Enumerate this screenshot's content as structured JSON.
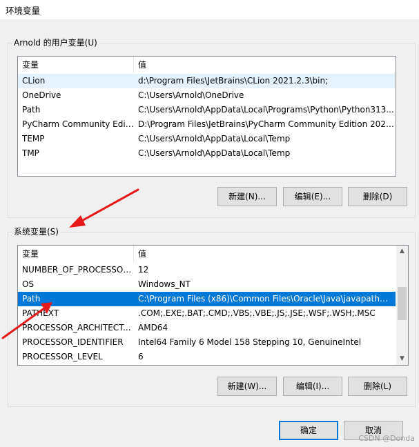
{
  "window": {
    "title": "环境变量"
  },
  "user_vars": {
    "group_label": "Arnold 的用户变量(U)",
    "columns": [
      "变量",
      "值"
    ],
    "rows": [
      {
        "name": "CLion",
        "value": "d:\\Program Files\\JetBrains\\CLion 2021.2.3\\bin;"
      },
      {
        "name": "OneDrive",
        "value": "C:\\Users\\Arnold\\OneDrive"
      },
      {
        "name": "Path",
        "value": "C:\\Users\\Arnold\\AppData\\Local\\Programs\\Python\\Python313..."
      },
      {
        "name": "PyCharm Community Editi...",
        "value": "D:\\Program Files\\JetBrains\\PyCharm Community Edition 2021..."
      },
      {
        "name": "TEMP",
        "value": "C:\\Users\\Arnold\\AppData\\Local\\Temp"
      },
      {
        "name": "TMP",
        "value": "C:\\Users\\Arnold\\AppData\\Local\\Temp"
      }
    ],
    "buttons": {
      "new": "新建(N)...",
      "edit": "编辑(E)...",
      "delete": "删除(D)"
    }
  },
  "system_vars": {
    "group_label": "系统变量(S)",
    "columns": [
      "变量",
      "值"
    ],
    "rows": [
      {
        "name": "NUMBER_OF_PROCESSORS",
        "value": "12"
      },
      {
        "name": "OS",
        "value": "Windows_NT"
      },
      {
        "name": "Path",
        "value": "C:\\Program Files (x86)\\Common Files\\Oracle\\Java\\javapath;D:..."
      },
      {
        "name": "PATHEXT",
        "value": ".COM;.EXE;.BAT;.CMD;.VBS;.VBE;.JS;.JSE;.WSF;.WSH;.MSC"
      },
      {
        "name": "PROCESSOR_ARCHITECT...",
        "value": "AMD64"
      },
      {
        "name": "PROCESSOR_IDENTIFIER",
        "value": "Intel64 Family 6 Model 158 Stepping 10, GenuineIntel"
      },
      {
        "name": "PROCESSOR_LEVEL",
        "value": "6"
      }
    ],
    "selected_row": "Path",
    "buttons": {
      "new": "新建(W)...",
      "edit": "编辑(I)...",
      "delete": "删除(L)"
    }
  },
  "dialog_buttons": {
    "ok": "确定",
    "cancel": "取消"
  },
  "watermark": "CSDN @Donda",
  "colors": {
    "selection": "#0078d7",
    "hover": "#e5f3ff",
    "annotation_arrow": "#e8191b",
    "default_button_border": "#0078d7"
  }
}
